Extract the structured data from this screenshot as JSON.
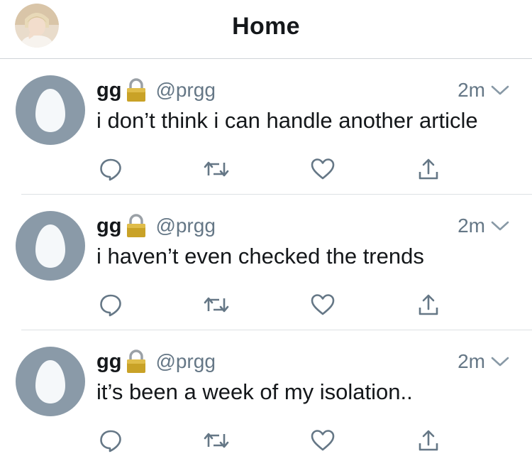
{
  "header": {
    "title": "Home",
    "avatar_icon": "profile-photo-avatar"
  },
  "colors": {
    "text_primary": "#14171a",
    "text_secondary": "#657786",
    "icon_gray": "#657786",
    "default_avatar_bg": "#8a9aa8",
    "default_avatar_egg": "#f5f8fa",
    "divider": "#dde1e4",
    "lock_gold": "#c9a227"
  },
  "tweets": [
    {
      "name": "gg",
      "handle": "@prgg",
      "time": "2m",
      "text": "i don’t think i can handle another article",
      "protected_icon": "lock-icon"
    },
    {
      "name": "gg",
      "handle": "@prgg",
      "time": "2m",
      "text": "i haven’t even checked the trends",
      "protected_icon": "lock-icon"
    },
    {
      "name": "gg",
      "handle": "@prgg",
      "time": "2m",
      "text": "it’s been a week of my isolation..",
      "protected_icon": "lock-icon"
    }
  ],
  "actions": [
    "reply-icon",
    "retweet-icon",
    "like-icon",
    "share-icon"
  ]
}
